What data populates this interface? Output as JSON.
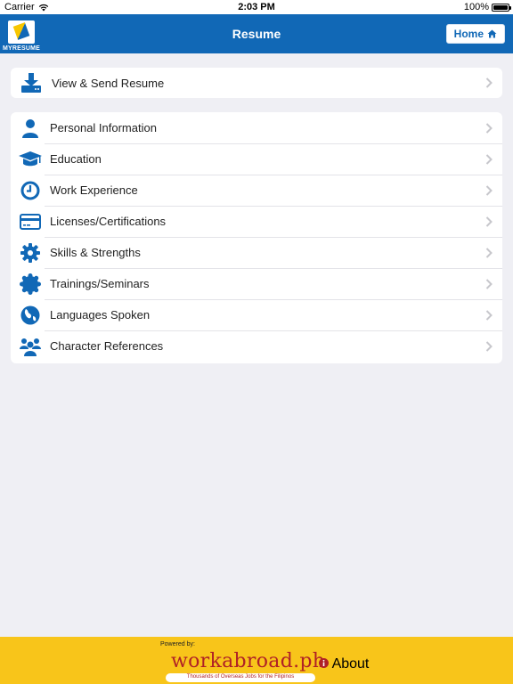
{
  "status_bar": {
    "carrier": "Carrier",
    "time": "2:03 PM",
    "battery": "100%"
  },
  "nav": {
    "logo_text": "MYRESUME",
    "title": "Resume",
    "home_label": "Home"
  },
  "send": {
    "label": "View & Send Resume",
    "icon": "download-icon"
  },
  "sections": [
    {
      "label": "Personal Information",
      "icon": "person-icon"
    },
    {
      "label": "Education",
      "icon": "graduation-cap-icon"
    },
    {
      "label": "Work Experience",
      "icon": "clock-icon"
    },
    {
      "label": "Licenses/Certifications",
      "icon": "credit-card-icon"
    },
    {
      "label": "Skills & Strengths",
      "icon": "gear-icon"
    },
    {
      "label": "Trainings/Seminars",
      "icon": "badge-icon"
    },
    {
      "label": "Languages Spoken",
      "icon": "globe-icon"
    },
    {
      "label": "Character References",
      "icon": "people-icon"
    }
  ],
  "footer": {
    "powered_by": "Powered by:",
    "brand": "workabroad.ph",
    "tagline": "Thousands of Overseas Jobs for the Filipinos",
    "about_label": "About"
  },
  "colors": {
    "nav_blue": "#1168b6",
    "footer_yellow": "#f8c51a",
    "brand_red": "#b02126",
    "background": "#efeff4"
  }
}
